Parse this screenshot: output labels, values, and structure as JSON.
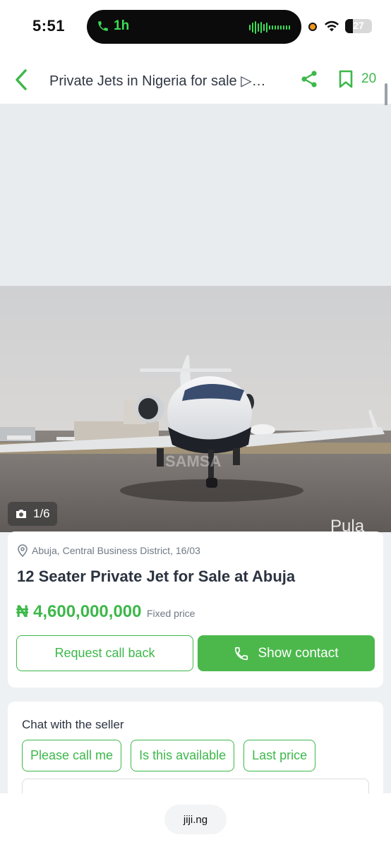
{
  "status_bar": {
    "time": "5:51",
    "call_duration": "1h",
    "battery": "27"
  },
  "header": {
    "title": "Private Jets in Nigeria for sale ▷…",
    "saved_count": "20"
  },
  "gallery": {
    "counter": "1/6",
    "current_index": 1,
    "total": 6
  },
  "listing": {
    "location": "Abuja, Central Business District, 16/03",
    "title": "12 Seater Private Jet for Sale at Abuja",
    "price": "₦ 4,600,000,000",
    "price_note": "Fixed price",
    "request_callback_label": "Request call back",
    "show_contact_label": "Show contact"
  },
  "chat": {
    "title": "Chat with the seller",
    "quick_replies": [
      "Please call me",
      "Is this available",
      "Last price"
    ]
  },
  "browser": {
    "url": "jiji.ng"
  },
  "colors": {
    "brand_green": "#3db84a",
    "text_dark": "#2b3340",
    "muted": "#6f7a86"
  },
  "icons": [
    "phone-icon",
    "wifi-icon",
    "back-arrow-icon",
    "share-icon",
    "bookmark-icon",
    "camera-icon",
    "location-pin-icon"
  ]
}
